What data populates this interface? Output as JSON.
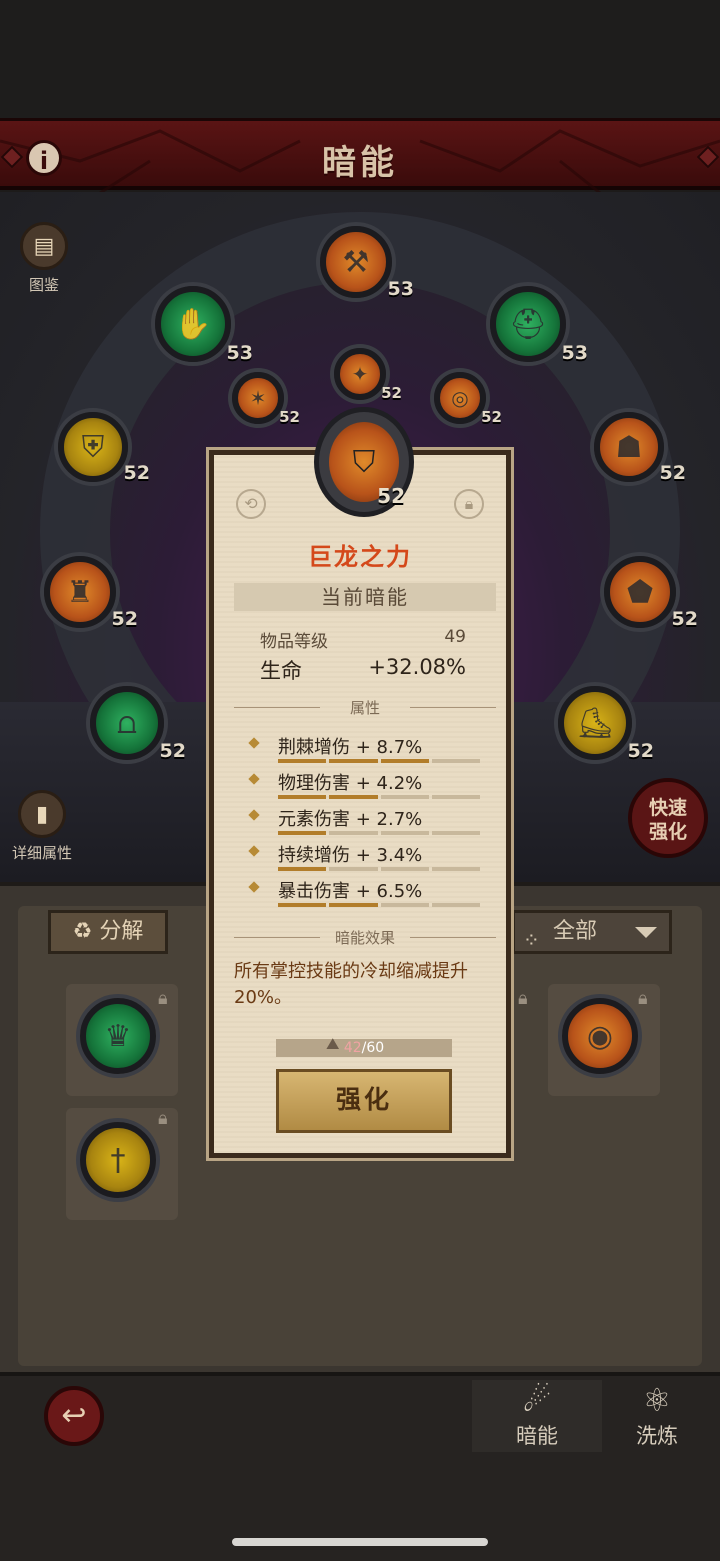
{
  "header": {
    "title": "暗能"
  },
  "side": {
    "codex_label": "图鉴",
    "details_label": "详细属性",
    "quick_enhance": "快速强化"
  },
  "slots": [
    {
      "level": "53",
      "color": "orange"
    },
    {
      "level": "53",
      "color": "green"
    },
    {
      "level": "53",
      "color": "green"
    },
    {
      "level": "52",
      "color": "orange"
    },
    {
      "level": "52",
      "color": "orange"
    },
    {
      "level": "52",
      "color": "orange"
    },
    {
      "level": "52",
      "color": "yellow"
    },
    {
      "level": "52",
      "color": "orange"
    },
    {
      "level": "52",
      "color": "orange"
    },
    {
      "level": "52",
      "color": "orange"
    },
    {
      "level": "52",
      "color": "green"
    },
    {
      "level": "52",
      "color": "yellow"
    }
  ],
  "toolbar": {
    "decompose": "分解",
    "filter": "全部"
  },
  "popup": {
    "item_level": "52",
    "name": "巨龙之力",
    "current_section": "当前暗能",
    "item_level_label": "物品等级",
    "item_level_value": "49",
    "main_stat_label": "生命",
    "main_stat_value": "+32.08%",
    "attr_header": "属性",
    "attributes": [
      {
        "text": "荆棘增伤 + 8.7%",
        "filled": 3
      },
      {
        "text": "物理伤害 + 4.2%",
        "filled": 2
      },
      {
        "text": "元素伤害 + 2.7%",
        "filled": 1
      },
      {
        "text": "持续增伤 + 3.4%",
        "filled": 1
      },
      {
        "text": "暴击伤害 + 6.5%",
        "filled": 2
      }
    ],
    "effect_header": "暗能效果",
    "effect_text": "所有掌控技能的冷却缩减提升20%。",
    "material_current": "42",
    "material_max": "/60",
    "enhance_label": "强化"
  },
  "bottom": {
    "tab_dark": "暗能",
    "tab_refine": "洗炼"
  },
  "colors": {
    "accent_red": "#d4481a",
    "banner": "#5a1414"
  }
}
